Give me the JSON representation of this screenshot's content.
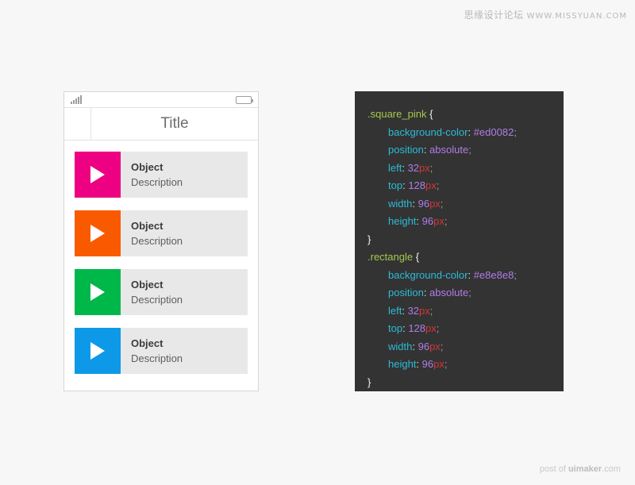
{
  "watermarks": {
    "top_cn": "思缘设计论坛",
    "top_url": "WWW.MISSYUAN.COM",
    "bottom_prefix": "post of ",
    "bottom_brand": "uimaker",
    "bottom_suffix": ".com"
  },
  "phone": {
    "status_bar": {
      "signal_icon": "signal-bars-icon",
      "battery_icon": "battery-icon"
    },
    "title_bar": {
      "title": "Title",
      "back_label": ""
    },
    "list_items": [
      {
        "title": "Object",
        "description": "Description",
        "thumb_color": "#ed0082",
        "icon": "play-icon"
      },
      {
        "title": "Object",
        "description": "Description",
        "thumb_color": "#f95a00",
        "icon": "play-icon"
      },
      {
        "title": "Object",
        "description": "Description",
        "thumb_color": "#00b74a",
        "icon": "play-icon"
      },
      {
        "title": "Object",
        "description": "Description",
        "thumb_color": "#0d99e8",
        "icon": "play-icon"
      }
    ],
    "row_background": "#e8e8e8"
  },
  "code": {
    "background": "#333333",
    "rules": [
      {
        "selector": ".square_pink",
        "open_brace": "{",
        "close_brace": "}",
        "declarations": [
          {
            "property": "background-color",
            "value": "#ed0082",
            "unit": ""
          },
          {
            "property": "position",
            "value": "absolute",
            "unit": ""
          },
          {
            "property": "left",
            "value": "32",
            "unit": "px"
          },
          {
            "property": "top",
            "value": "128",
            "unit": "px"
          },
          {
            "property": "width",
            "value": "96",
            "unit": "px"
          },
          {
            "property": "height",
            "value": "96",
            "unit": "px"
          }
        ]
      },
      {
        "selector": ".rectangle",
        "open_brace": "{",
        "close_brace": "}",
        "declarations": [
          {
            "property": "background-color",
            "value": "#e8e8e8",
            "unit": ""
          },
          {
            "property": "position",
            "value": "absolute",
            "unit": ""
          },
          {
            "property": "left",
            "value": "32",
            "unit": "px"
          },
          {
            "property": "top",
            "value": "128",
            "unit": "px"
          },
          {
            "property": "width",
            "value": "96",
            "unit": "px"
          },
          {
            "property": "height",
            "value": "96",
            "unit": "px"
          }
        ]
      }
    ],
    "tokens": {
      "colon": ":",
      "semicolon": ";"
    }
  }
}
